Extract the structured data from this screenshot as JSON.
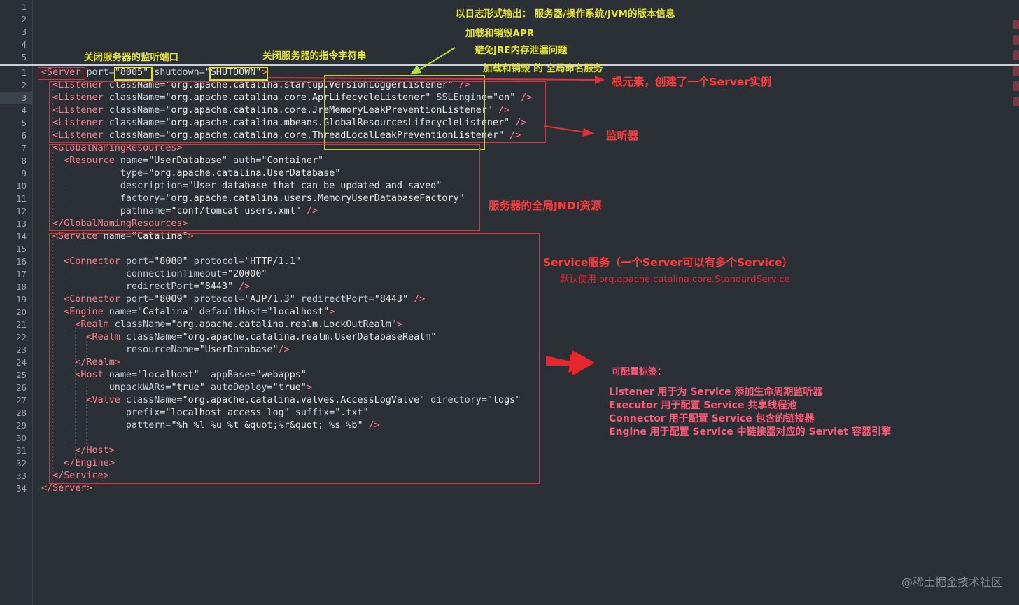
{
  "top_pane": {
    "line_numbers": [
      "1",
      "2",
      "3",
      "4",
      "5"
    ]
  },
  "code_lines": [
    {
      "num": "1",
      "segs": [
        [
          "tag",
          "<Server"
        ],
        [
          "attr",
          " port="
        ],
        [
          "str",
          "\"8005\""
        ],
        [
          "attr",
          " shutdown="
        ],
        [
          "str",
          "\"SHUTDOWN\""
        ],
        [
          "tag",
          ">"
        ]
      ]
    },
    {
      "num": "2",
      "segs": [
        [
          "tag",
          "  <Listener"
        ],
        [
          "attr",
          " className="
        ],
        [
          "str",
          "\"org.apache.catalina.startup.VersionLoggerListener\""
        ],
        [
          "tag",
          " />"
        ]
      ]
    },
    {
      "num": "3",
      "segs": [
        [
          "tag",
          "  <Listener"
        ],
        [
          "attr",
          " className="
        ],
        [
          "str",
          "\"org.apache.catalina.core.AprLifecycleListener\""
        ],
        [
          "attr",
          " SSLEngine="
        ],
        [
          "str",
          "\"on\""
        ],
        [
          "tag",
          " />"
        ]
      ]
    },
    {
      "num": "4",
      "segs": [
        [
          "tag",
          "  <Listener"
        ],
        [
          "attr",
          " className="
        ],
        [
          "str",
          "\"org.apache.catalina.core.JreMemoryLeakPreventionListener\""
        ],
        [
          "tag",
          " />"
        ]
      ]
    },
    {
      "num": "5",
      "segs": [
        [
          "tag",
          "  <Listener"
        ],
        [
          "attr",
          " className="
        ],
        [
          "str",
          "\"org.apache.catalina.mbeans.GlobalResourcesLifecycleListener\""
        ],
        [
          "tag",
          " />"
        ]
      ]
    },
    {
      "num": "6",
      "segs": [
        [
          "tag",
          "  <Listener"
        ],
        [
          "attr",
          " className="
        ],
        [
          "str",
          "\"org.apache.catalina.core.ThreadLocalLeakPreventionListener\""
        ],
        [
          "tag",
          " />"
        ]
      ]
    },
    {
      "num": "7",
      "segs": [
        [
          "tag",
          "  <GlobalNamingResources>"
        ]
      ]
    },
    {
      "num": "8",
      "segs": [
        [
          "tag",
          "    <Resource"
        ],
        [
          "attr",
          " name="
        ],
        [
          "str",
          "\"UserDatabase\""
        ],
        [
          "attr",
          " auth="
        ],
        [
          "str",
          "\"Container\""
        ]
      ]
    },
    {
      "num": "9",
      "segs": [
        [
          "attr",
          "              type="
        ],
        [
          "str",
          "\"org.apache.catalina.UserDatabase\""
        ]
      ]
    },
    {
      "num": "10",
      "segs": [
        [
          "attr",
          "              description="
        ],
        [
          "str",
          "\"User database that can be updated and saved\""
        ]
      ]
    },
    {
      "num": "11",
      "segs": [
        [
          "attr",
          "              factory="
        ],
        [
          "str",
          "\"org.apache.catalina.users.MemoryUserDatabaseFactory\""
        ]
      ]
    },
    {
      "num": "12",
      "segs": [
        [
          "attr",
          "              pathname="
        ],
        [
          "str",
          "\"conf/tomcat-users.xml\""
        ],
        [
          "tag",
          " />"
        ]
      ]
    },
    {
      "num": "13",
      "segs": [
        [
          "tag",
          "  </GlobalNamingResources>"
        ]
      ]
    },
    {
      "num": "14",
      "segs": [
        [
          "tag",
          "  <Service"
        ],
        [
          "attr",
          " name="
        ],
        [
          "str",
          "\"Catalina\""
        ],
        [
          "tag",
          ">"
        ]
      ]
    },
    {
      "num": "15",
      "segs": []
    },
    {
      "num": "16",
      "segs": [
        [
          "tag",
          "    <Connector"
        ],
        [
          "attr",
          " port="
        ],
        [
          "str",
          "\"8080\""
        ],
        [
          "attr",
          " protocol="
        ],
        [
          "str",
          "\"HTTP/1.1\""
        ]
      ]
    },
    {
      "num": "17",
      "segs": [
        [
          "attr",
          "               connectionTimeout="
        ],
        [
          "str",
          "\"20000\""
        ]
      ]
    },
    {
      "num": "18",
      "segs": [
        [
          "attr",
          "               redirectPort="
        ],
        [
          "str",
          "\"8443\""
        ],
        [
          "tag",
          " />"
        ]
      ]
    },
    {
      "num": "19",
      "segs": [
        [
          "tag",
          "    <Connector"
        ],
        [
          "attr",
          " port="
        ],
        [
          "str",
          "\"8009\""
        ],
        [
          "attr",
          " protocol="
        ],
        [
          "str",
          "\"AJP/1.3\""
        ],
        [
          "attr",
          " redirectPort="
        ],
        [
          "str",
          "\"8443\""
        ],
        [
          "tag",
          " />"
        ]
      ]
    },
    {
      "num": "20",
      "segs": [
        [
          "tag",
          "    <Engine"
        ],
        [
          "attr",
          " name="
        ],
        [
          "str",
          "\"Catalina\""
        ],
        [
          "attr",
          " defaultHost="
        ],
        [
          "str",
          "\"localhost\""
        ],
        [
          "tag",
          ">"
        ]
      ]
    },
    {
      "num": "21",
      "segs": [
        [
          "tag",
          "      <Realm"
        ],
        [
          "attr",
          " className="
        ],
        [
          "str",
          "\"org.apache.catalina.realm.LockOutRealm\""
        ],
        [
          "tag",
          ">"
        ]
      ]
    },
    {
      "num": "22",
      "segs": [
        [
          "tag",
          "        <Realm"
        ],
        [
          "attr",
          " className="
        ],
        [
          "str",
          "\"org.apache.catalina.realm.UserDatabaseRealm\""
        ]
      ]
    },
    {
      "num": "23",
      "segs": [
        [
          "attr",
          "               resourceName="
        ],
        [
          "str",
          "\"UserDatabase\""
        ],
        [
          "tag",
          "/>"
        ]
      ]
    },
    {
      "num": "24",
      "segs": [
        [
          "tag",
          "      </Realm>"
        ]
      ]
    },
    {
      "num": "25",
      "segs": [
        [
          "tag",
          "      <Host"
        ],
        [
          "attr",
          " name="
        ],
        [
          "str",
          "\"localhost\""
        ],
        [
          "attr",
          "  appBase="
        ],
        [
          "str",
          "\"webapps\""
        ]
      ]
    },
    {
      "num": "26",
      "segs": [
        [
          "attr",
          "            unpackWARs="
        ],
        [
          "str",
          "\"true\""
        ],
        [
          "attr",
          " autoDeploy="
        ],
        [
          "str",
          "\"true\""
        ],
        [
          "tag",
          ">"
        ]
      ]
    },
    {
      "num": "27",
      "segs": [
        [
          "tag",
          "        <Valve"
        ],
        [
          "attr",
          " className="
        ],
        [
          "str",
          "\"org.apache.catalina.valves.AccessLogValve\""
        ],
        [
          "attr",
          " directory="
        ],
        [
          "str",
          "\"logs\""
        ]
      ]
    },
    {
      "num": "28",
      "segs": [
        [
          "attr",
          "               prefix="
        ],
        [
          "str",
          "\"localhost_access_log\""
        ],
        [
          "attr",
          " suffix="
        ],
        [
          "str",
          "\".txt\""
        ]
      ]
    },
    {
      "num": "29",
      "segs": [
        [
          "attr",
          "               pattern="
        ],
        [
          "str",
          "\"%h %l %u %t &quot;%r&quot; %s %b\""
        ],
        [
          "tag",
          " />"
        ]
      ]
    },
    {
      "num": "30",
      "segs": []
    },
    {
      "num": "31",
      "segs": [
        [
          "tag",
          "      </Host>"
        ]
      ]
    },
    {
      "num": "32",
      "segs": [
        [
          "tag",
          "    </Engine>"
        ]
      ]
    },
    {
      "num": "33",
      "segs": [
        [
          "tag",
          "  </Service>"
        ]
      ]
    },
    {
      "num": "34",
      "segs": [
        [
          "tag",
          "</Server>"
        ]
      ]
    }
  ],
  "annotations": {
    "version_info": "以日志形式输出： 服务器/操作系统/JVM的版本信息",
    "apr": "加载和销毁APR",
    "jre_leak": "避免JRE内存泄漏问题",
    "global_naming": "加载和销毁 的 全局命名服务",
    "shutdown_port": "关闭服务器的监听端口",
    "shutdown_cmd": "关闭服务器的指令字符串",
    "root_element": "根元素，创建了一个Server实例",
    "listener": "监听器",
    "jndi": "服务器的全局JNDI资源",
    "service_title": "Service服务（一个Server可以有多个Service）",
    "service_default": "默认使用 org.apache.catalina.core.StandardService",
    "configurable_title": "可配置标签：",
    "configurable_items": [
      "Listener  用于为 Service 添加生命周期监听器",
      "Executor  用于配置 Service 共享线程池",
      "Connector 用于配置 Service 包含的链接器",
      "Engine 用于配置 Service 中链接器对应的 Servlet 容器引擎"
    ]
  },
  "watermark": "@稀土掘金技术社区",
  "colors": {
    "tag": "#ff7e8a",
    "red_annotation": "#ff3b3b",
    "yellow_annotation": "#e6e43a",
    "background": "#2b3036"
  }
}
